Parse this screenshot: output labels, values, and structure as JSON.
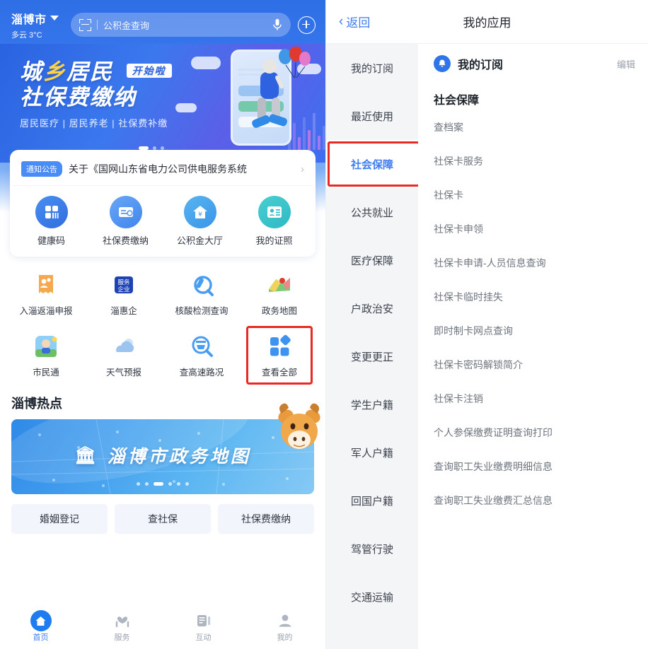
{
  "left": {
    "header": {
      "city": "淄博市",
      "city_dropdown_icon": "chevron-down-icon",
      "weather": "多云 3°C",
      "scan_icon": "scan-code-icon",
      "search_placeholder": "公积金查询",
      "mic_icon": "microphone-icon",
      "plus_icon": "plus-circle-icon"
    },
    "banner": {
      "line1_a": "城",
      "line1_b": "乡",
      "line1_c": "居民",
      "badge": "开始啦",
      "line2": "社保费缴纳",
      "subtitle": "居民医疗 | 居民养老 | 社保费补缴",
      "dots_total": 3,
      "dots_active": 1
    },
    "notice": {
      "badge": "通知公告",
      "text": "关于《国网山东省电力公司供电服务系统",
      "arrow_icon": "chevron-right-icon"
    },
    "quick_actions": [
      {
        "label": "健康码",
        "icon": "health-code-icon"
      },
      {
        "label": "社保费缴纳",
        "icon": "social-insurance-payment-icon"
      },
      {
        "label": "公积金大厅",
        "icon": "housing-fund-hall-icon"
      },
      {
        "label": "我的证照",
        "icon": "my-certificates-icon"
      }
    ],
    "app_grid": [
      {
        "label": "入淄返淄申报",
        "icon": "report-entry-icon"
      },
      {
        "label": "淄惠企",
        "icon": "enterprise-service-icon"
      },
      {
        "label": "核酸检测查询",
        "icon": "nucleic-acid-test-icon"
      },
      {
        "label": "政务地图",
        "icon": "gov-map-icon"
      },
      {
        "label": "市民通",
        "icon": "citizen-pass-icon"
      },
      {
        "label": "天气预报",
        "icon": "weather-forecast-icon"
      },
      {
        "label": "查高速路况",
        "icon": "highway-traffic-icon"
      },
      {
        "label": "查看全部",
        "icon": "view-all-icon",
        "highlighted": true
      }
    ],
    "hotspot": {
      "title": "淄博热点",
      "map_banner_title": "淄博市政务地图",
      "map_banner_glyph": "gov-building-icon",
      "mascot": "ox-mascot",
      "dots_total": 6,
      "dots_active": 3
    },
    "tags": [
      "婚姻登记",
      "查社保",
      "社保费缴纳"
    ],
    "tabbar": [
      {
        "label": "首页",
        "icon": "home-icon",
        "active": true
      },
      {
        "label": "服务",
        "icon": "service-hands-icon",
        "active": false
      },
      {
        "label": "互动",
        "icon": "interaction-icon",
        "active": false
      },
      {
        "label": "我的",
        "icon": "user-profile-icon",
        "active": false
      }
    ]
  },
  "right": {
    "back_label": "返回",
    "back_icon": "chevron-left-icon",
    "title": "我的应用",
    "sidebar": [
      {
        "label": "我的订阅",
        "active": false
      },
      {
        "label": "最近使用",
        "active": false
      },
      {
        "label": "社会保障",
        "active": true,
        "highlighted": true
      },
      {
        "label": "公共就业",
        "active": false
      },
      {
        "label": "医疗保障",
        "active": false
      },
      {
        "label": "户政治安",
        "active": false
      },
      {
        "label": "变更更正",
        "active": false
      },
      {
        "label": "学生户籍",
        "active": false
      },
      {
        "label": "军人户籍",
        "active": false
      },
      {
        "label": "回国户籍",
        "active": false
      },
      {
        "label": "驾管行驶",
        "active": false
      },
      {
        "label": "交通运输",
        "active": false
      }
    ],
    "subscription": {
      "icon": "bell-icon",
      "title": "我的订阅",
      "edit_label": "编辑"
    },
    "section_title": "社会保障",
    "services": [
      "查档案",
      "社保卡服务",
      "社保卡",
      "社保卡申领",
      "社保卡申请-人员信息查询",
      "社保卡临时挂失",
      "即时制卡网点查询",
      "社保卡密码解锁简介",
      "社保卡注销",
      "个人参保缴费证明查询打印",
      "查询职工失业缴费明细信息",
      "查询职工失业缴费汇总信息"
    ]
  },
  "colors": {
    "brand_blue": "#3f7df0",
    "highlight_red": "#ea2a22",
    "accent_yellow": "#ffd24a",
    "sidebar_bg": "#f4f5f7"
  }
}
